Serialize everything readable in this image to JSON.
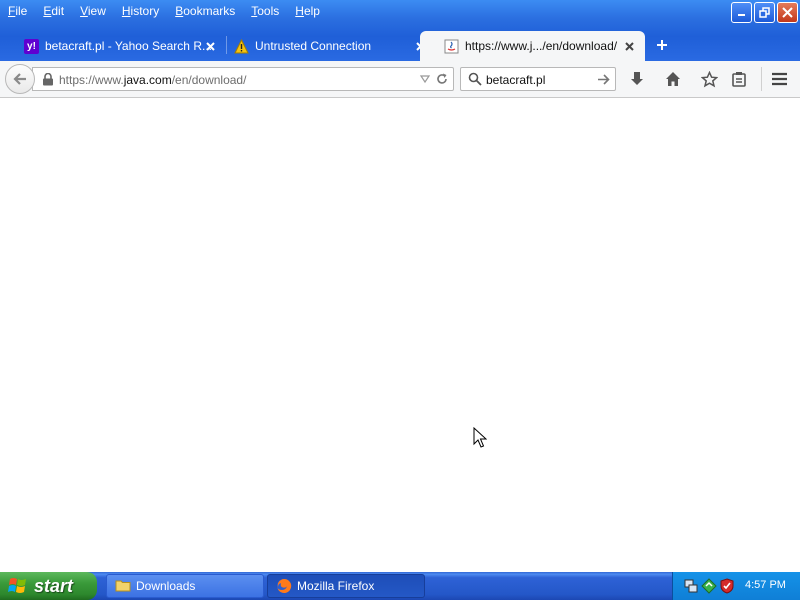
{
  "menu": {
    "items": [
      {
        "label": "File",
        "u": "F",
        "rest": "ile"
      },
      {
        "label": "Edit",
        "u": "E",
        "rest": "dit"
      },
      {
        "label": "View",
        "u": "V",
        "rest": "iew"
      },
      {
        "label": "History",
        "u": "H",
        "rest": "istory"
      },
      {
        "label": "Bookmarks",
        "u": "B",
        "rest": "ookmarks"
      },
      {
        "label": "Tools",
        "u": "T",
        "rest": "ools"
      },
      {
        "label": "Help",
        "u": "H",
        "rest": "elp"
      }
    ]
  },
  "tabs": [
    {
      "title": "betacraft.pl - Yahoo Search R...",
      "icon": "yahoo-icon"
    },
    {
      "title": "Untrusted Connection",
      "icon": "warning-icon"
    },
    {
      "title": "https://www.j.../en/download/",
      "icon": "java-page-icon",
      "active": true
    }
  ],
  "urlbar": {
    "prefix": "https://www.",
    "domain": "java.com",
    "path": "/en/download/"
  },
  "search": {
    "value": "betacraft.pl"
  },
  "taskbar": {
    "start_label": "start",
    "items": [
      {
        "label": "Downloads",
        "icon": "folder-icon"
      },
      {
        "label": "Mozilla Firefox",
        "icon": "firefox-icon",
        "active": true
      }
    ],
    "clock": "4:57 PM"
  },
  "colors": {
    "title_blue": "#2b6fe0",
    "taskbar_blue": "#2457c8",
    "start_green": "#3a9a3a",
    "tray_blue": "#1592e8"
  }
}
